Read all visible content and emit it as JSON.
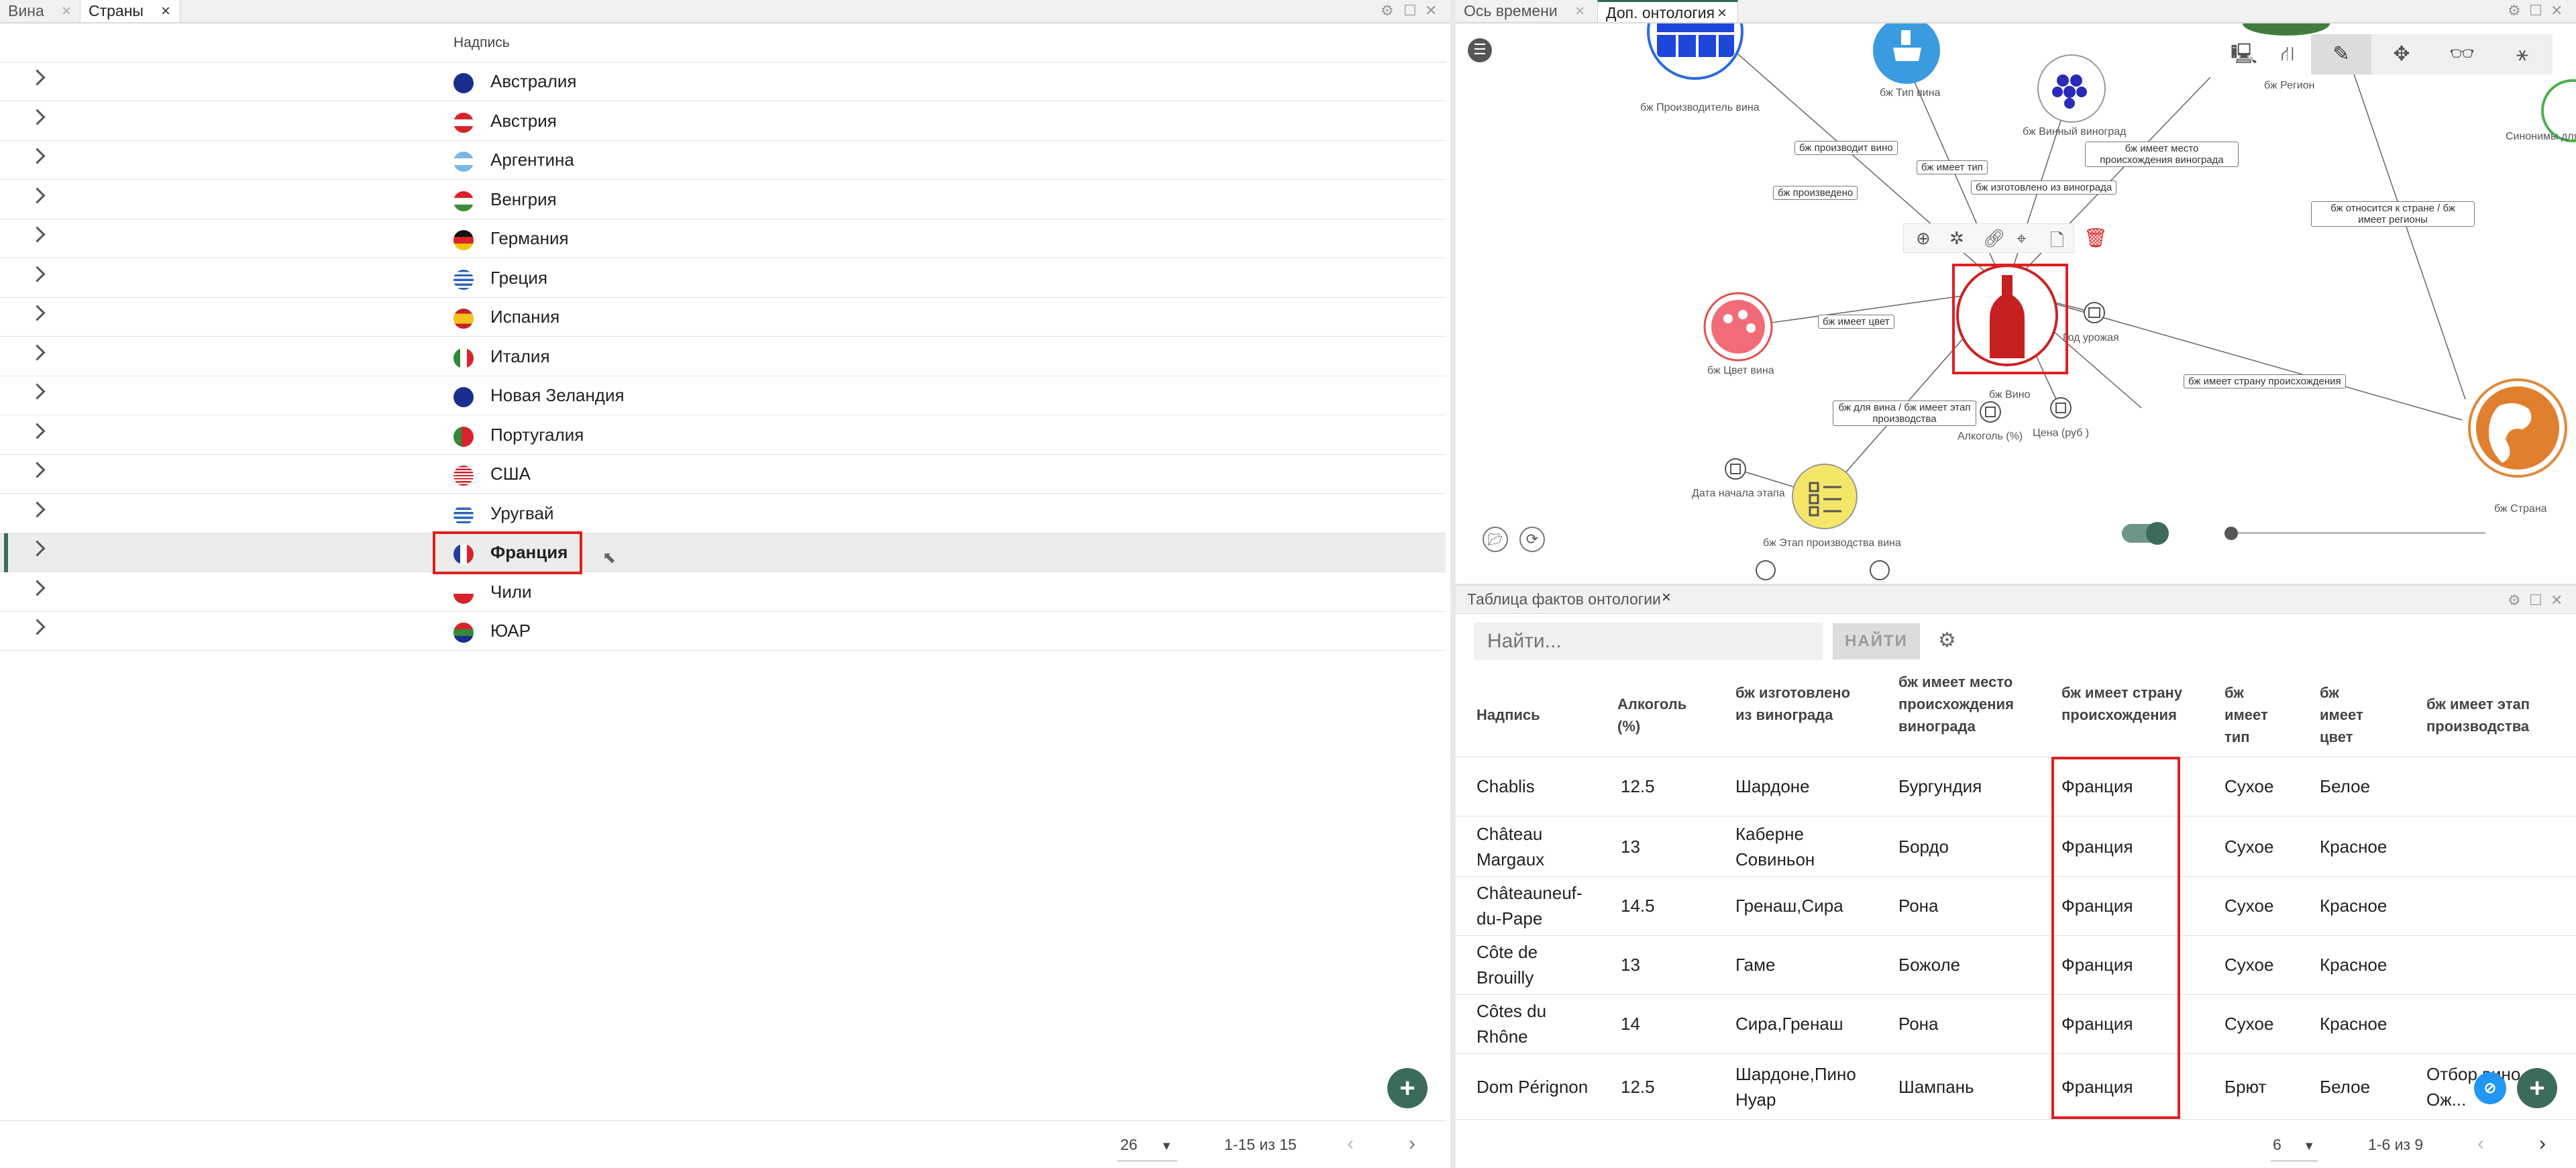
{
  "left_tabs": [
    {
      "label": "Вина",
      "active": false
    },
    {
      "label": "Страны",
      "active": true
    }
  ],
  "right_tabs": [
    {
      "label": "Ось времени",
      "active": false
    },
    {
      "label": "Доп. онтология",
      "active": true
    }
  ],
  "left_table": {
    "column_header": "Надпись",
    "rows": [
      {
        "name": "Австралия",
        "flag": "australia-flag"
      },
      {
        "name": "Австрия",
        "flag": "austria-flag"
      },
      {
        "name": "Аргентина",
        "flag": "argentina-flag"
      },
      {
        "name": "Венгрия",
        "flag": "hungary-flag"
      },
      {
        "name": "Германия",
        "flag": "germany-flag"
      },
      {
        "name": "Греция",
        "flag": "greece-flag"
      },
      {
        "name": "Испания",
        "flag": "spain-flag"
      },
      {
        "name": "Италия",
        "flag": "italy-flag"
      },
      {
        "name": "Новая Зеландия",
        "flag": "new-zealand-flag"
      },
      {
        "name": "Португалия",
        "flag": "portugal-flag"
      },
      {
        "name": "США",
        "flag": "usa-flag"
      },
      {
        "name": "Уругвай",
        "flag": "uruguay-flag"
      },
      {
        "name": "Франция",
        "flag": "france-flag",
        "selected": true
      },
      {
        "name": "Чили",
        "flag": "chile-flag"
      },
      {
        "name": "ЮАР",
        "flag": "south-africa-flag"
      }
    ],
    "page_size": "26",
    "range": "1-15 из 15"
  },
  "graph": {
    "nodes": [
      {
        "label": "бж Производитель вина",
        "icon": "factory-icon"
      },
      {
        "label": "бж Тип вина",
        "icon": "wine-glass-icon"
      },
      {
        "label": "бж Винный виноград",
        "icon": "grapes-icon"
      },
      {
        "label": "бж Регион",
        "icon": "region-icon"
      },
      {
        "label": "Синонимы для",
        "icon": "synonyms-icon"
      },
      {
        "label": "бж Цвет вина",
        "icon": "palette-icon"
      },
      {
        "label": "бж Вино",
        "icon": "wine-bottle-icon"
      },
      {
        "label": "Год урожая",
        "icon": "calendar-icon"
      },
      {
        "label": "Алкоголь (%)",
        "icon": "number-icon"
      },
      {
        "label": "Цена (руб )",
        "icon": "number-icon"
      },
      {
        "label": "бж Страна",
        "icon": "globe-icon"
      },
      {
        "label": "Дата начала этапа",
        "icon": "calendar-icon"
      },
      {
        "label": "бж Этап производства вина",
        "icon": "checklist-icon"
      }
    ],
    "edge_labels": [
      "бж производит вино",
      "бж произведено",
      "бж имеет тип",
      "бж изготовлено из винограда",
      "бж имеет место происхождения винограда",
      "бж относится к стране / бж имеет регионы",
      "бж имеет цвет",
      "бж имеет страну происхождения",
      "бж для вина / бж имеет этап производства"
    ]
  },
  "facts": {
    "title": "Таблица фактов онтологии",
    "search_placeholder": "Найти...",
    "search_button": "НАЙТИ",
    "columns": [
      "Надпись",
      "Алкоголь (%)",
      "бж изготовлено из винограда",
      "бж имеет место происхождения винограда",
      "бж имеет страну происхождения",
      "бж имеет тип",
      "бж имеет цвет",
      "бж имеет этап производства"
    ],
    "rows": [
      {
        "name": "Chablis",
        "alcohol": "12.5",
        "grape": "Шардоне",
        "place": "Бургундия",
        "country": "Франция",
        "type": "Сухое",
        "color": "Белое",
        "stage": ""
      },
      {
        "name": "Château Margaux",
        "alcohol": "13",
        "grape": "Каберне Совиньон",
        "place": "Бордо",
        "country": "Франция",
        "type": "Сухое",
        "color": "Красное",
        "stage": ""
      },
      {
        "name": "Châteauneuf-du-Pape",
        "alcohol": "14.5",
        "grape": "Гренаш,Сира",
        "place": "Рона",
        "country": "Франция",
        "type": "Сухое",
        "color": "Красное",
        "stage": ""
      },
      {
        "name": "Côte de Brouilly",
        "alcohol": "13",
        "grape": "Гаме",
        "place": "Божоле",
        "country": "Франция",
        "type": "Сухое",
        "color": "Красное",
        "stage": ""
      },
      {
        "name": "Côtes du Rhône",
        "alcohol": "14",
        "grape": "Сира,Гренаш",
        "place": "Рона",
        "country": "Франция",
        "type": "Сухое",
        "color": "Красное",
        "stage": ""
      },
      {
        "name": "Dom Pérignon",
        "alcohol": "12.5",
        "grape": "Шардоне,Пино Нуар",
        "place": "Шампань",
        "country": "Франция",
        "type": "Брют",
        "color": "Белое",
        "stage": "Отбор вино...а, Ож..."
      }
    ],
    "page_size": "6",
    "range": "1-6 из 9"
  },
  "colors": {
    "accent": "#3d6b5b",
    "highlight": "#e02020"
  }
}
